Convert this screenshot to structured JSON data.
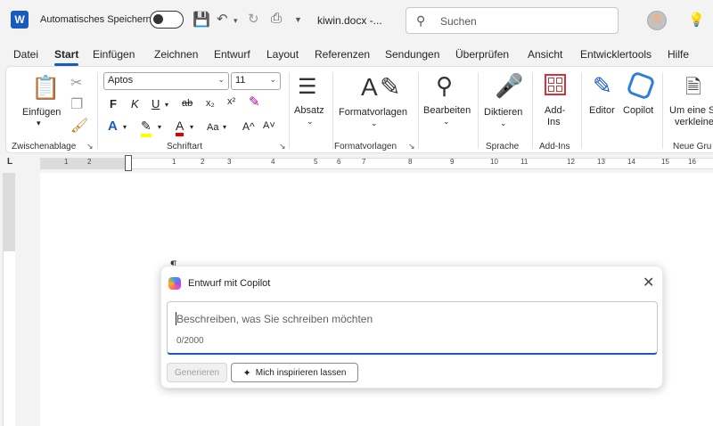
{
  "titlebar": {
    "app_logo": "W",
    "autosave_label": "Automatisches Speichern",
    "doc_title": "kiwin.docx -...",
    "search_placeholder": "Suchen"
  },
  "tabs": [
    "Datei",
    "Start",
    "Einfügen",
    "Zeichnen",
    "Entwurf",
    "Layout",
    "Referenzen",
    "Sendungen",
    "Überprüfen",
    "Ansicht",
    "Entwicklertools",
    "Hilfe"
  ],
  "active_tab": "Start",
  "ribbon": {
    "clipboard": {
      "paste_label": "Einfügen",
      "group_label": "Zwischenablage"
    },
    "font": {
      "font_name": "Aptos",
      "font_size": "11",
      "group_label": "Schriftart",
      "bold": "F",
      "italic": "K",
      "underline": "U",
      "strike": "ab",
      "sub": "x₂",
      "sup": "x²",
      "grow": "A^",
      "shrink": "A˅",
      "case": "Aa"
    },
    "paragraph": {
      "label": "Absatz"
    },
    "styles": {
      "label": "Formatvorlagen",
      "group_label": "Formatvorlagen"
    },
    "editing": {
      "label": "Bearbeiten"
    },
    "voice": {
      "label": "Diktieren",
      "group_label": "Sprache"
    },
    "addins": {
      "label_line1": "Add-",
      "label_line2": "Ins",
      "group_label": "Add-Ins"
    },
    "editor": {
      "label": "Editor"
    },
    "copilot": {
      "label": "Copilot"
    },
    "new_group": {
      "label_line1": "Um eine S",
      "label_line2": "verkleine",
      "group_label": "Neue Gru"
    }
  },
  "ruler_numbers": [
    "1",
    "2",
    "1",
    "2",
    "3",
    "4",
    "5",
    "6",
    "7",
    "8",
    "9",
    "10",
    "11",
    "12",
    "13",
    "14",
    "15",
    "16"
  ],
  "copilot_dialog": {
    "title": "Entwurf mit Copilot",
    "prompt_placeholder": "Beschreiben, was Sie schreiben möchten",
    "char_count": "0/2000",
    "generate_button": "Generieren",
    "inspire_button": "Mich inspirieren lassen"
  },
  "colors": {
    "accent": "#185abd",
    "highlight": "#ffff00",
    "font_color": "#e00000",
    "save_icon": "#b4009e"
  }
}
